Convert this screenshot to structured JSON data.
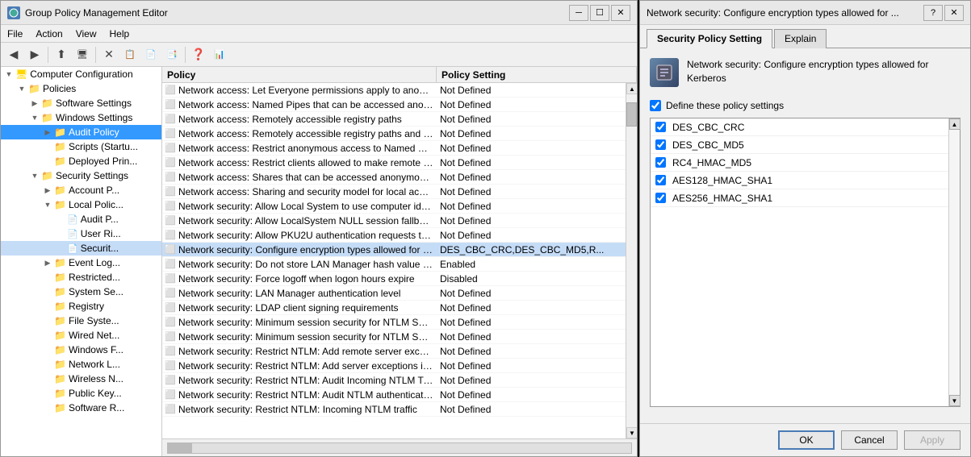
{
  "mainWindow": {
    "title": "Group Policy Management Editor",
    "icon": "⚙"
  },
  "menuBar": {
    "items": [
      "File",
      "Action",
      "View",
      "Help"
    ]
  },
  "toolbar": {
    "buttons": [
      "◀",
      "▶",
      "⬆",
      "🖥",
      "✕",
      "📋",
      "📄",
      "📑",
      "❓",
      "📊"
    ]
  },
  "sidebar": {
    "scrollUp": "▲",
    "scrollDown": "▼",
    "nodes": [
      {
        "id": "computer-config",
        "label": "Computer Configuration",
        "indent": 0,
        "expanded": true,
        "type": "folder"
      },
      {
        "id": "policies",
        "label": "Policies",
        "indent": 1,
        "expanded": true,
        "type": "folder"
      },
      {
        "id": "software-settings",
        "label": "Software Settings",
        "indent": 2,
        "expanded": false,
        "type": "folder"
      },
      {
        "id": "windows-settings",
        "label": "Windows Settings",
        "indent": 2,
        "expanded": true,
        "type": "folder"
      },
      {
        "id": "audit-policy",
        "label": "Audit Policy",
        "indent": 3,
        "expanded": false,
        "type": "folder",
        "selected": true
      },
      {
        "id": "scripts",
        "label": "Scripts (Startu...",
        "indent": 3,
        "expanded": false,
        "type": "folder"
      },
      {
        "id": "deployed-printers",
        "label": "Deployed Prin...",
        "indent": 3,
        "expanded": false,
        "type": "folder"
      },
      {
        "id": "security-settings",
        "label": "Security Settings",
        "indent": 3,
        "expanded": true,
        "type": "folder"
      },
      {
        "id": "account-p",
        "label": "Account P...",
        "indent": 4,
        "expanded": false,
        "type": "folder"
      },
      {
        "id": "local-polic",
        "label": "Local Polic...",
        "indent": 4,
        "expanded": true,
        "type": "folder"
      },
      {
        "id": "audit-p",
        "label": "Audit P...",
        "indent": 5,
        "expanded": false,
        "type": "page"
      },
      {
        "id": "user-ri",
        "label": "User Ri...",
        "indent": 5,
        "expanded": false,
        "type": "page"
      },
      {
        "id": "securit",
        "label": "Securit...",
        "indent": 5,
        "expanded": false,
        "type": "page",
        "highlighted": true
      },
      {
        "id": "event-log",
        "label": "Event Log...",
        "indent": 4,
        "expanded": false,
        "type": "folder"
      },
      {
        "id": "restricted",
        "label": "Restricted...",
        "indent": 4,
        "expanded": false,
        "type": "folder"
      },
      {
        "id": "system-se",
        "label": "System Se...",
        "indent": 4,
        "expanded": false,
        "type": "folder"
      },
      {
        "id": "registry",
        "label": "Registry",
        "indent": 4,
        "expanded": false,
        "type": "folder"
      },
      {
        "id": "file-system",
        "label": "File Syste...",
        "indent": 4,
        "expanded": false,
        "type": "folder"
      },
      {
        "id": "wired-net",
        "label": "Wired Net...",
        "indent": 4,
        "expanded": false,
        "type": "folder"
      },
      {
        "id": "windows-f",
        "label": "Windows F...",
        "indent": 4,
        "expanded": false,
        "type": "folder"
      },
      {
        "id": "network-l",
        "label": "Network L...",
        "indent": 4,
        "expanded": false,
        "type": "folder"
      },
      {
        "id": "wireless-n",
        "label": "Wireless N...",
        "indent": 4,
        "expanded": false,
        "type": "folder"
      },
      {
        "id": "public-key",
        "label": "Public Key...",
        "indent": 4,
        "expanded": false,
        "type": "folder"
      },
      {
        "id": "software-r",
        "label": "Software R...",
        "indent": 4,
        "expanded": false,
        "type": "folder"
      }
    ]
  },
  "policyList": {
    "columns": [
      "Policy",
      "Policy Setting"
    ],
    "rows": [
      {
        "name": "Network access: Let Everyone permissions apply to anonym...",
        "value": "Not Defined",
        "highlighted": false
      },
      {
        "name": "Network access: Named Pipes that can be accessed anonym...",
        "value": "Not Defined",
        "highlighted": false
      },
      {
        "name": "Network access: Remotely accessible registry paths",
        "value": "Not Defined",
        "highlighted": false
      },
      {
        "name": "Network access: Remotely accessible registry paths and sub...",
        "value": "Not Defined",
        "highlighted": false
      },
      {
        "name": "Network access: Restrict anonymous access to Named Pipes...",
        "value": "Not Defined",
        "highlighted": false
      },
      {
        "name": "Network access: Restrict clients allowed to make remote call...",
        "value": "Not Defined",
        "highlighted": false
      },
      {
        "name": "Network access: Shares that can be accessed anonymously",
        "value": "Not Defined",
        "highlighted": false
      },
      {
        "name": "Network access: Sharing and security model for local accou...",
        "value": "Not Defined",
        "highlighted": false
      },
      {
        "name": "Network security: Allow Local System to use computer ident...",
        "value": "Not Defined",
        "highlighted": false
      },
      {
        "name": "Network security: Allow LocalSystem NULL session fallback",
        "value": "Not Defined",
        "highlighted": false
      },
      {
        "name": "Network security: Allow PKU2U authentication requests to t...",
        "value": "Not Defined",
        "highlighted": false
      },
      {
        "name": "Network security: Configure encryption types allowed for Ke...",
        "value": "DES_CBC_CRC,DES_CBC_MD5,R...",
        "highlighted": true
      },
      {
        "name": "Network security: Do not store LAN Manager hash value on ...",
        "value": "Enabled",
        "highlighted": false
      },
      {
        "name": "Network security: Force logoff when logon hours expire",
        "value": "Disabled",
        "highlighted": false
      },
      {
        "name": "Network security: LAN Manager authentication level",
        "value": "Not Defined",
        "highlighted": false
      },
      {
        "name": "Network security: LDAP client signing requirements",
        "value": "Not Defined",
        "highlighted": false
      },
      {
        "name": "Network security: Minimum session security for NTLM SSP ...",
        "value": "Not Defined",
        "highlighted": false
      },
      {
        "name": "Network security: Minimum session security for NTLM SSP ...",
        "value": "Not Defined",
        "highlighted": false
      },
      {
        "name": "Network security: Restrict NTLM: Add remote server excepti...",
        "value": "Not Defined",
        "highlighted": false
      },
      {
        "name": "Network security: Restrict NTLM: Add server exceptions in t...",
        "value": "Not Defined",
        "highlighted": false
      },
      {
        "name": "Network security: Restrict NTLM: Audit Incoming NTLM Tra...",
        "value": "Not Defined",
        "highlighted": false
      },
      {
        "name": "Network security: Restrict NTLM: Audit NTLM authenticatio...",
        "value": "Not Defined",
        "highlighted": false
      },
      {
        "name": "Network security: Restrict NTLM: Incoming NTLM traffic",
        "value": "Not Defined",
        "highlighted": false
      }
    ]
  },
  "dialog": {
    "title": "Network security: Configure encryption types allowed for ...",
    "helpButton": "?",
    "closeButton": "✕",
    "tabs": [
      {
        "label": "Security Policy Setting",
        "active": true
      },
      {
        "label": "Explain",
        "active": false
      }
    ],
    "description": "Network security: Configure encryption types allowed for Kerberos",
    "defineCheckbox": {
      "label": "Define these policy settings",
      "checked": true
    },
    "encryptionTypes": [
      {
        "label": "DES_CBC_CRC",
        "checked": true
      },
      {
        "label": "DES_CBC_MD5",
        "checked": true
      },
      {
        "label": "RC4_HMAC_MD5",
        "checked": true
      },
      {
        "label": "AES128_HMAC_SHA1",
        "checked": true
      },
      {
        "label": "AES256_HMAC_SHA1",
        "checked": true
      }
    ],
    "buttons": {
      "ok": "OK",
      "cancel": "Cancel",
      "apply": "Apply"
    }
  }
}
